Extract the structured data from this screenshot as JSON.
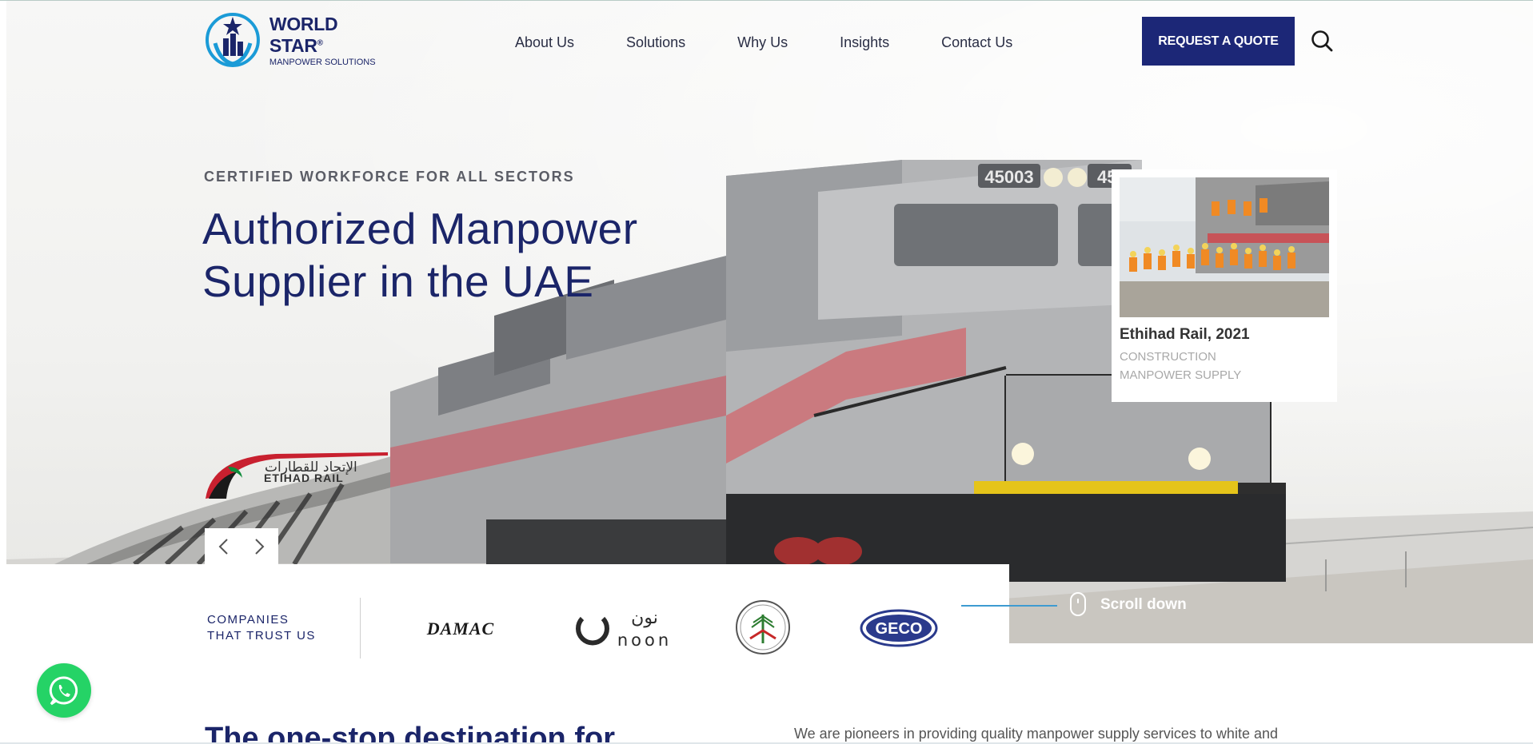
{
  "brand": {
    "name": "WORLD STAR",
    "registered": "®",
    "tagline": "MANPOWER SOLUTIONS",
    "primary_color": "#1c2777",
    "accent_color": "#3e9bd1"
  },
  "nav": {
    "items": [
      {
        "label": "About Us"
      },
      {
        "label": "Solutions"
      },
      {
        "label": "Why Us"
      },
      {
        "label": "Insights"
      },
      {
        "label": "Contact Us"
      }
    ],
    "cta_label": "REQUEST A QUOTE",
    "search_icon": "search-icon"
  },
  "hero": {
    "eyebrow": "CERTIFIED WORKFORCE FOR ALL SECTORS",
    "headline_line1": "Authorized Manpower",
    "headline_line2": "Supplier in the UAE",
    "locomotive_number": "45003",
    "locomotive_number_partial": "45",
    "partner_logo_arabic": "الإتحاد للقطارات",
    "partner_logo_text": "ETIHAD RAIL",
    "prev_icon": "chevron-left-icon",
    "next_icon": "chevron-right-icon"
  },
  "project_card": {
    "title": "Ethihad Rail, 2021",
    "subtitle": "CONSTRUCTION MANPOWER SUPPLY"
  },
  "clients": {
    "label": "COMPANIES THAT TRUST US",
    "logos": [
      "DAMAC",
      "نون",
      "noon",
      "GECO"
    ]
  },
  "scroll": {
    "label": "Scroll down"
  },
  "whatsapp": {
    "icon": "whatsapp-icon",
    "color": "#25d366"
  },
  "intro": {
    "title": "The one-stop destination for",
    "text": "We are pioneers in providing quality manpower supply services to white and"
  }
}
